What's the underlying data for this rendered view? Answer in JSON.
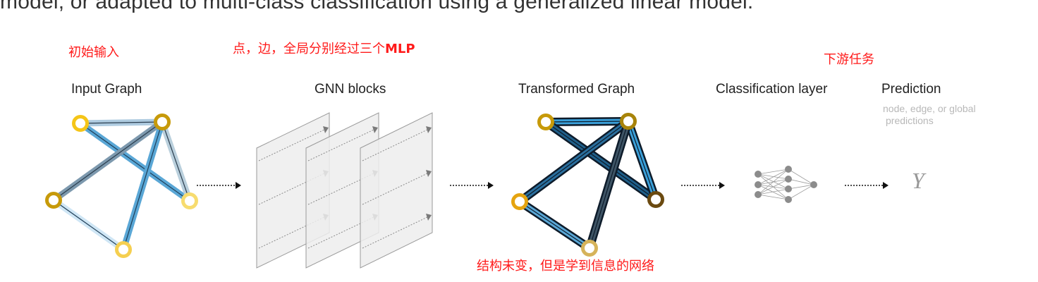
{
  "header": {
    "cropped_sentence": "model, or adapted to multi-class classification using a generalized linear model."
  },
  "labels": {
    "input_graph": "Input Graph",
    "gnn_blocks": "GNN blocks",
    "transformed_graph": "Transformed Graph",
    "classification_layer": "Classification layer",
    "prediction": "Prediction",
    "prediction_hint_line1": "node, edge, or global",
    "prediction_hint_line2": "predictions",
    "output_symbol": "Y"
  },
  "annotations": {
    "initial_input": "初始输入",
    "mlp_note_prefix": "点，边，全局分别经过三个",
    "mlp_note_bold": "MLP",
    "downstream_task": "下游任务",
    "structure_note": "结构未变，但是学到信息的网络"
  },
  "colors": {
    "text_dark": "#222222",
    "annotation_red": "#ff1a1a",
    "hint_gray": "#b8b8b8",
    "node_yellow_light": "#f5d15a",
    "node_yellow_dark": "#d4a30a",
    "node_brown": "#6b4a10",
    "edge_blue": "#5aa7d6",
    "edge_dark": "#1f3e57",
    "panel_fill": "#eeeeee",
    "panel_stroke": "#9a9a9a",
    "classifier_gray": "#8c8c8c"
  },
  "icons": [
    "arrow-right-icon",
    "neural-network-icon"
  ]
}
